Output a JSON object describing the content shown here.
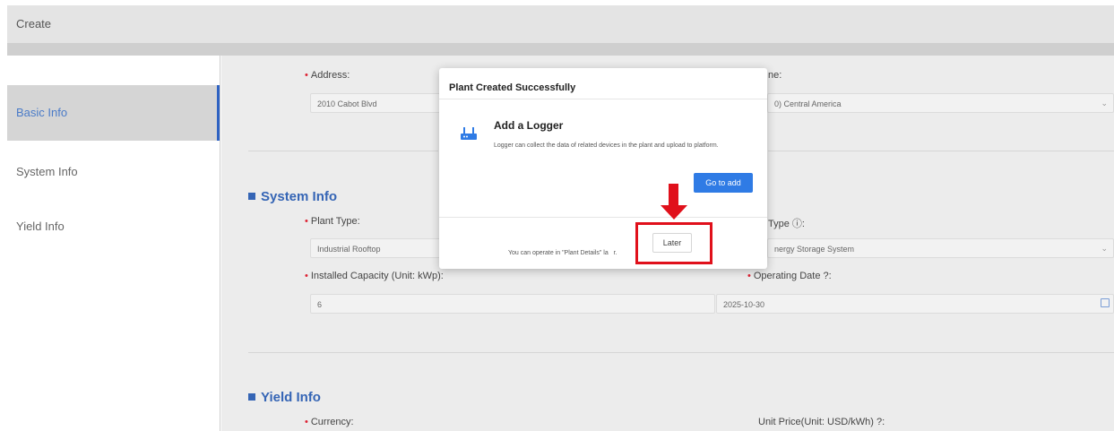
{
  "header": {
    "title": "Create"
  },
  "sidebar": {
    "items": [
      {
        "label": "Basic Info",
        "active": true
      },
      {
        "label": "System Info",
        "active": false
      },
      {
        "label": "Yield Info",
        "active": false
      }
    ]
  },
  "form": {
    "address": {
      "label": "Address:",
      "value": "2010 Cabot Blvd"
    },
    "timezone": {
      "label": "Time Zone:",
      "visible_label": "ne:",
      "value": "(UTC-06:00) Central America",
      "visible_value": "0) Central America"
    },
    "system_section_title": "System Info",
    "plant_type": {
      "label": "Plant Type:",
      "value": "Industrial Rooftop"
    },
    "system_type": {
      "visible_label": "Type",
      "visible_value": "nergy Storage System"
    },
    "installed_capacity": {
      "label": "Installed Capacity (Unit: kWp):",
      "value": "6"
    },
    "operating_date": {
      "label": "Operating Date",
      "value": "2025-10-30"
    },
    "yield_section_title": "Yield Info",
    "currency": {
      "label": "Currency:"
    },
    "unit_price": {
      "label": "Unit Price(Unit: USD/kWh)"
    }
  },
  "modal": {
    "title": "Plant Created Successfully",
    "logger_title": "Add a Logger",
    "logger_description": "Logger can collect the data of related devices in the plant and upload to platform.",
    "go_to_add_label": "Go to add",
    "footer_text": "You can operate in \"Plant Details\" la",
    "footer_text_tail": "r.",
    "later_label": "Later"
  },
  "colors": {
    "accent": "#3565b5",
    "primary_button": "#2f7be5",
    "required": "#dd2233",
    "annotation": "#e0101b"
  },
  "icons": {
    "info": "info-circle-icon",
    "help": "question-circle-icon",
    "calendar": "calendar-icon",
    "chevron": "chevron-down-icon",
    "logger": "router-icon"
  }
}
